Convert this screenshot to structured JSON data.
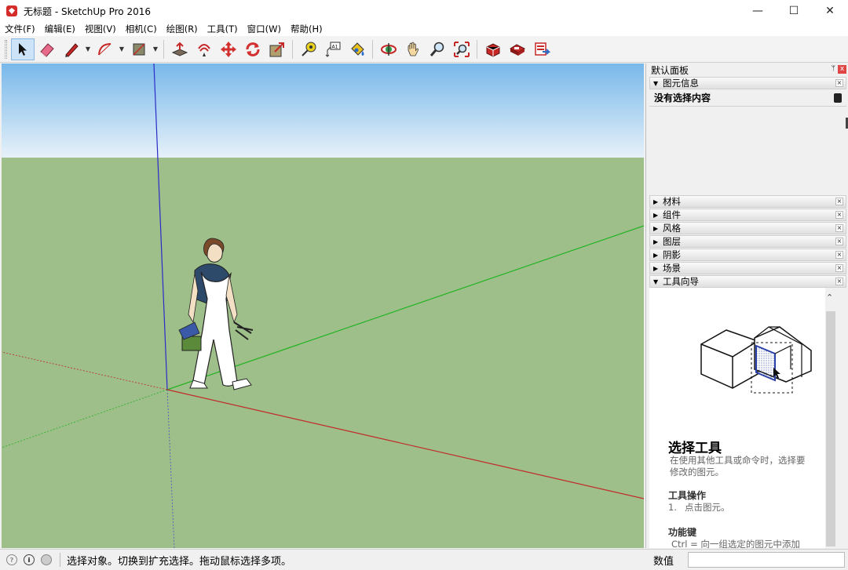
{
  "window": {
    "title": "无标题 - SketchUp Pro 2016",
    "minimize": "—",
    "maximize": "☐",
    "close": "✕"
  },
  "menu": [
    {
      "label": "文件(F)"
    },
    {
      "label": "编辑(E)"
    },
    {
      "label": "视图(V)"
    },
    {
      "label": "相机(C)"
    },
    {
      "label": "绘图(R)"
    },
    {
      "label": "工具(T)"
    },
    {
      "label": "窗口(W)"
    },
    {
      "label": "帮助(H)"
    }
  ],
  "toolbar": {
    "tools": [
      "select",
      "eraser",
      "line",
      "arc",
      "rectangle",
      "push-pull",
      "offset",
      "move",
      "rotate",
      "scale",
      "tape-measure",
      "text",
      "paint-bucket",
      "orbit",
      "pan",
      "zoom",
      "zoom-extents",
      "warehouse",
      "extension-warehouse",
      "send-to-layout"
    ]
  },
  "tray": {
    "title": "默认面板",
    "pin": "ᛘ",
    "close": "x",
    "entity_info": {
      "header": "图元信息",
      "status": "没有选择内容"
    },
    "panels": [
      {
        "label": "材料"
      },
      {
        "label": "组件"
      },
      {
        "label": "风格"
      },
      {
        "label": "图层"
      },
      {
        "label": "阴影"
      },
      {
        "label": "场景"
      }
    ],
    "instructor": {
      "header": "工具向导",
      "title": "选择工具",
      "description": "在使用其他工具或命令时，选择要修改的图元。",
      "operation_header": "工具操作",
      "step_number": "1.",
      "step_text": "点击图元。",
      "modifier_header": "功能键",
      "modifier_text": "Ctrl = 向一组选定的图元中添加"
    }
  },
  "status": {
    "message": "选择对象。切换到扩充选择。拖动鼠标选择多项。",
    "measure_label": "数值",
    "measure_value": ""
  },
  "colors": {
    "sky_top": "#78b8ea",
    "sky_bottom": "#e6f1f9",
    "ground": "#9ebe8a",
    "axis_red": "#c02a2a",
    "axis_green": "#22b422",
    "axis_blue": "#2b2bc8"
  }
}
